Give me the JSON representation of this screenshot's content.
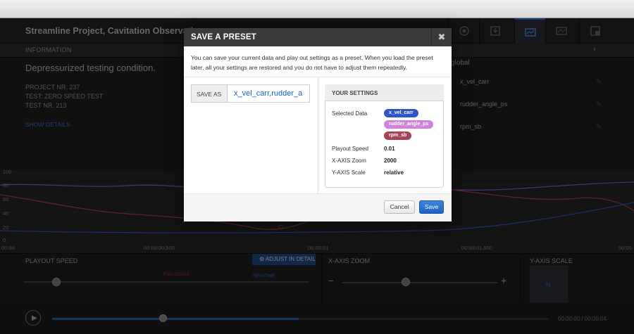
{
  "app": {
    "title": "Streamline Project, Cavitation Observation"
  },
  "info_bar": {
    "label": "INFORMATION"
  },
  "info": {
    "heading": "Depressurized testing condition.",
    "lines": [
      "PROJECT NR. 237",
      "TEST: ZERO SPEED TEST",
      "TEST NR. 213"
    ],
    "show_details": "SHOW DETAILS"
  },
  "data_list": {
    "title": "global",
    "items": [
      "x_vel_carr",
      "rudder_angle_ps",
      "rpm_sb"
    ]
  },
  "chart": {
    "y_ticks": [
      "100",
      "80",
      "60",
      "40",
      "20",
      "0"
    ],
    "x_ticks": [
      "00:00",
      "00:00:00,500",
      "00:00:01",
      "00:00:01,500",
      "00:00"
    ]
  },
  "controls": {
    "playout_speed_label": "PLAYOUT SPEED",
    "adjust_label": "ADJUST IN DETAIL",
    "full_scale": "FULLSCALE",
    "realtime": "REALTIME",
    "xaxis_zoom_label": "X-AXIS ZOOM",
    "yaxis_scale_label": "Y-AXIS SCALE",
    "minus": "−",
    "plus": "+",
    "percent": "%"
  },
  "playback": {
    "time": "00:00:00 / 00:00:04",
    "progress": 0.5
  },
  "modal": {
    "title": "SAVE A PRESET",
    "close": "✖",
    "description": "You can save your current data and play out settings as a preset. When you load the preset later, all your settings are restored and you do not have to adjust them repeatedly.",
    "save_as_label": "SAVE AS",
    "save_as_value": "x_vel_carr,rudder_a",
    "settings_title": "YOUR SETTINGS",
    "selected_data_label": "Selected Data",
    "tags": [
      {
        "label": "x_vel_carr",
        "color": "#2e55c8"
      },
      {
        "label": "rudder_angle_ps",
        "color": "#d083dc"
      },
      {
        "label": "rpm_sb",
        "color": "#a4435a"
      }
    ],
    "playout_speed_label": "Playout Speed",
    "playout_speed_value": "0.01",
    "xaxis_zoom_label": "X-AXIS Zoom",
    "xaxis_zoom_value": "2000",
    "yaxis_scale_label": "Y-AXIS Scale",
    "yaxis_scale_value": "relative",
    "cancel_label": "Cancel",
    "save_label": "Save"
  },
  "colors": {
    "accent": "#1f62c2",
    "series_blue": "#2e55c8",
    "series_purple": "#8c5ad2",
    "series_red": "#a4435a"
  }
}
